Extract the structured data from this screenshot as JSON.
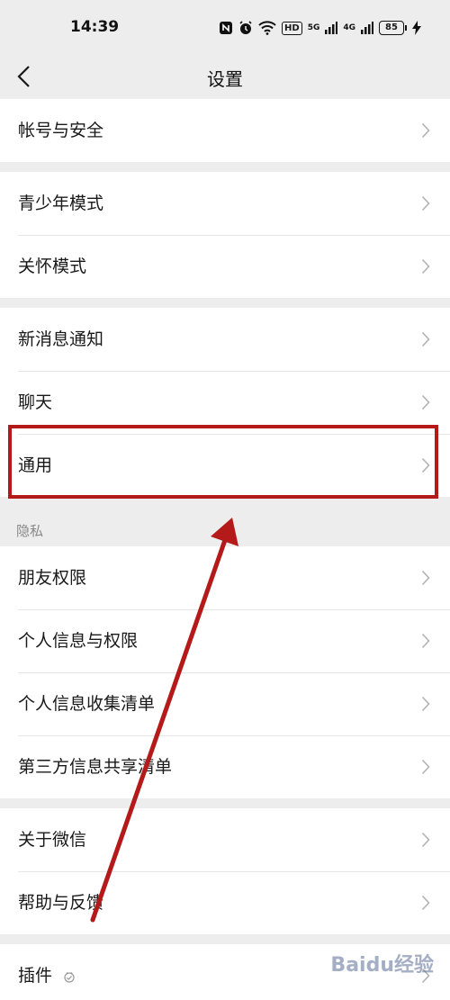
{
  "status_bar": {
    "time": "14:39",
    "hd_label": "HD",
    "net1": "5G",
    "net2": "4G",
    "battery": "85"
  },
  "nav": {
    "title": "设置"
  },
  "groups": [
    {
      "items": [
        {
          "label": "帐号与安全"
        }
      ]
    },
    {
      "items": [
        {
          "label": "青少年模式"
        },
        {
          "label": "关怀模式"
        }
      ]
    },
    {
      "items": [
        {
          "label": "新消息通知"
        },
        {
          "label": "聊天"
        },
        {
          "label": "通用"
        }
      ]
    },
    {
      "header": "隐私",
      "items": [
        {
          "label": "朋友权限"
        },
        {
          "label": "个人信息与权限"
        },
        {
          "label": "个人信息收集清单"
        },
        {
          "label": "第三方信息共享清单"
        }
      ]
    },
    {
      "items": [
        {
          "label": "关于微信"
        },
        {
          "label": "帮助与反馈"
        }
      ]
    },
    {
      "items": [
        {
          "label": "插件"
        }
      ]
    }
  ],
  "watermark": "Baidu经验",
  "colors": {
    "background": "#ededed",
    "row_background": "#ffffff",
    "annotation": "#b51a1a"
  }
}
